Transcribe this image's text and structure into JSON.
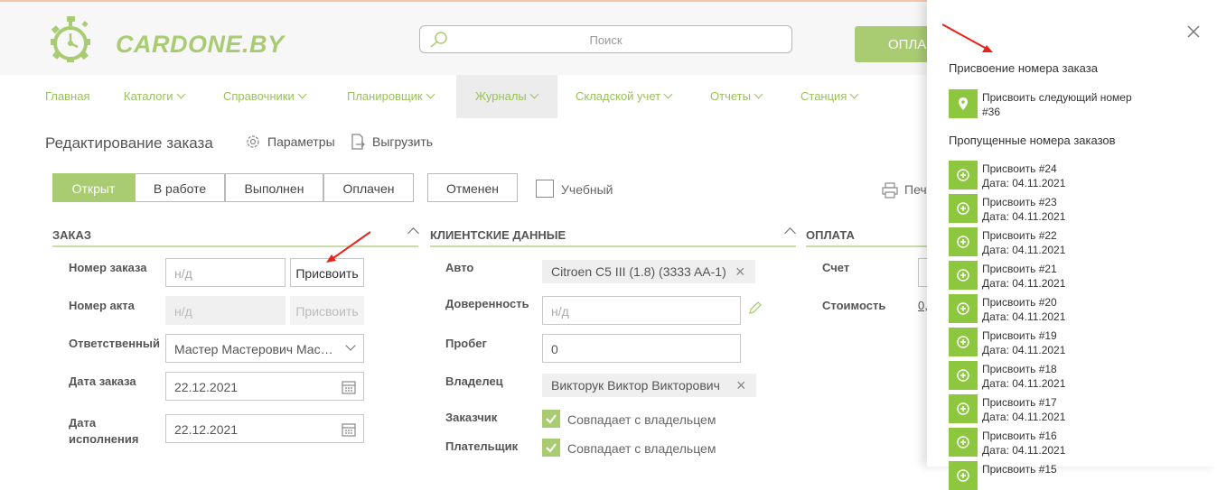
{
  "header": {
    "brand": "CARDONE.BY",
    "search_placeholder": "Поиск",
    "pay_button": "ОПЛА"
  },
  "nav": {
    "items": [
      {
        "label": "Главная"
      },
      {
        "label": "Каталоги"
      },
      {
        "label": "Справочники"
      },
      {
        "label": "Планировщик"
      },
      {
        "label": "Журналы"
      },
      {
        "label": "Складской учет"
      },
      {
        "label": "Отчеты"
      },
      {
        "label": "Станция"
      }
    ],
    "active": "Журналы"
  },
  "page": {
    "title": "Редактирование заказа",
    "params_label": "Параметры",
    "export_label": "Выгрузить",
    "print_label": "Печ"
  },
  "statuses": [
    "Открыт",
    "В работе",
    "Выполнен",
    "Оплачен",
    "Отменен"
  ],
  "active_status": "Открыт",
  "training": {
    "label": "Учебный",
    "checked": false
  },
  "order": {
    "section_title": "ЗАКАЗ",
    "number_label": "Номер заказа",
    "number_placeholder": "н/д",
    "assign_button": "Присвоить",
    "act_label": "Номер акта",
    "act_placeholder": "н/д",
    "act_assign_button": "Присвоить",
    "responsible_label": "Ответственный",
    "responsible_value": "Мастер Мастерович Мастерович",
    "date_label": "Дата заказа",
    "date_value": "22.12.2021",
    "done_label_1": "Дата",
    "done_label_2": "исполнения",
    "done_value": "22.12.2021"
  },
  "client": {
    "section_title": "КЛИЕНТСКИЕ ДАННЫЕ",
    "auto_label": "Авто",
    "auto_value": "Citroen C5 III (1.8) (3333 AA-1)",
    "proxy_label": "Доверенность",
    "proxy_placeholder": "н/д",
    "mileage_label": "Пробег",
    "mileage_value": "0",
    "owner_label": "Владелец",
    "owner_value": "Викторук Виктор Викторович",
    "customer_label": "Заказчик",
    "customer_value": "Совпадает с владельцем",
    "payer_label": "Плательщик",
    "payer_value": "Совпадает с владельцем"
  },
  "payment": {
    "section_title": "ОПЛАТА",
    "account_label": "Счет",
    "cost_label": "Стоимость",
    "cost_value": "0,"
  },
  "panel": {
    "title": "Присвоение номера заказа",
    "next_line1": "Присвоить следующий номер",
    "next_line2": "#36",
    "missed_title": "Пропущенные номера заказов",
    "missed": [
      {
        "label": "Присвоить #24",
        "date": "Дата: 04.11.2021"
      },
      {
        "label": "Присвоить #23",
        "date": "Дата: 04.11.2021"
      },
      {
        "label": "Присвоить #22",
        "date": "Дата: 04.11.2021"
      },
      {
        "label": "Присвоить #21",
        "date": "Дата: 04.11.2021"
      },
      {
        "label": "Присвоить #20",
        "date": "Дата: 04.11.2021"
      },
      {
        "label": "Присвоить #19",
        "date": "Дата: 04.11.2021"
      },
      {
        "label": "Присвоить #18",
        "date": "Дата: 04.11.2021"
      },
      {
        "label": "Присвоить #17",
        "date": "Дата: 04.11.2021"
      },
      {
        "label": "Присвоить #16",
        "date": "Дата: 04.11.2021"
      },
      {
        "label": "Присвоить #15",
        "date": ""
      }
    ]
  },
  "colors": {
    "accent": "#a9cc73",
    "accent_dark": "#8dc63f",
    "annotation_arrow": "#e8231b"
  }
}
